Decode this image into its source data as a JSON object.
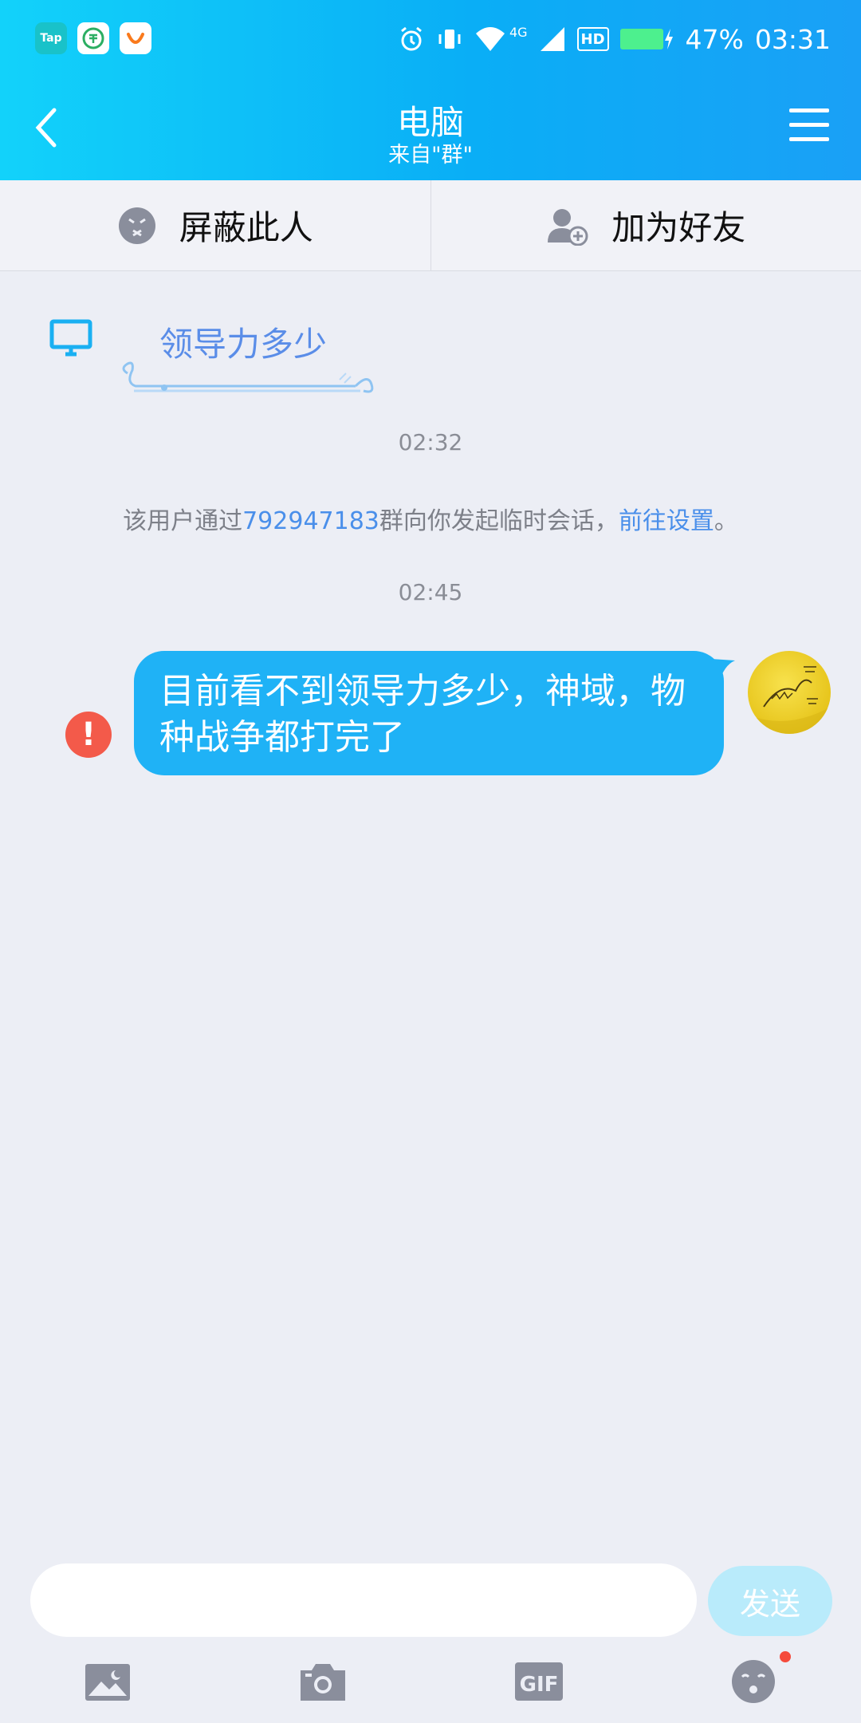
{
  "status_bar": {
    "apps": [
      "Tap"
    ],
    "network": "4G",
    "hd": "HD",
    "battery": "47%",
    "time": "03:31"
  },
  "nav": {
    "title": "电脑",
    "subtitle": "来自\"群\""
  },
  "actions": {
    "block_label": "屏蔽此人",
    "add_friend_label": "加为好友"
  },
  "chat": {
    "sender_nick": "领导力多少",
    "time_1": "02:32",
    "system_msg": {
      "prefix": "该用户通过",
      "group_id": "792947183",
      "middle": "群向你发起临时会话，",
      "link": "前往设置",
      "suffix": "。"
    },
    "time_2": "02:45",
    "outgoing_message": "目前看不到领导力多少，神域，物种战争都打完了",
    "error_mark": "!"
  },
  "composer": {
    "input_value": "",
    "send_label": "发送"
  },
  "toolbar": {
    "icons": [
      "image-icon",
      "camera-icon",
      "gif-icon",
      "emoji-icon"
    ],
    "gif_label": "GIF"
  },
  "colors": {
    "header_gradient_start": "#12d2fa",
    "header_gradient_end": "#1aa0f6",
    "bubble": "#1fb2f6",
    "link": "#4a8fea",
    "error": "#f35a4a",
    "send_button": "#b9ebfb",
    "background": "#eceef5"
  }
}
